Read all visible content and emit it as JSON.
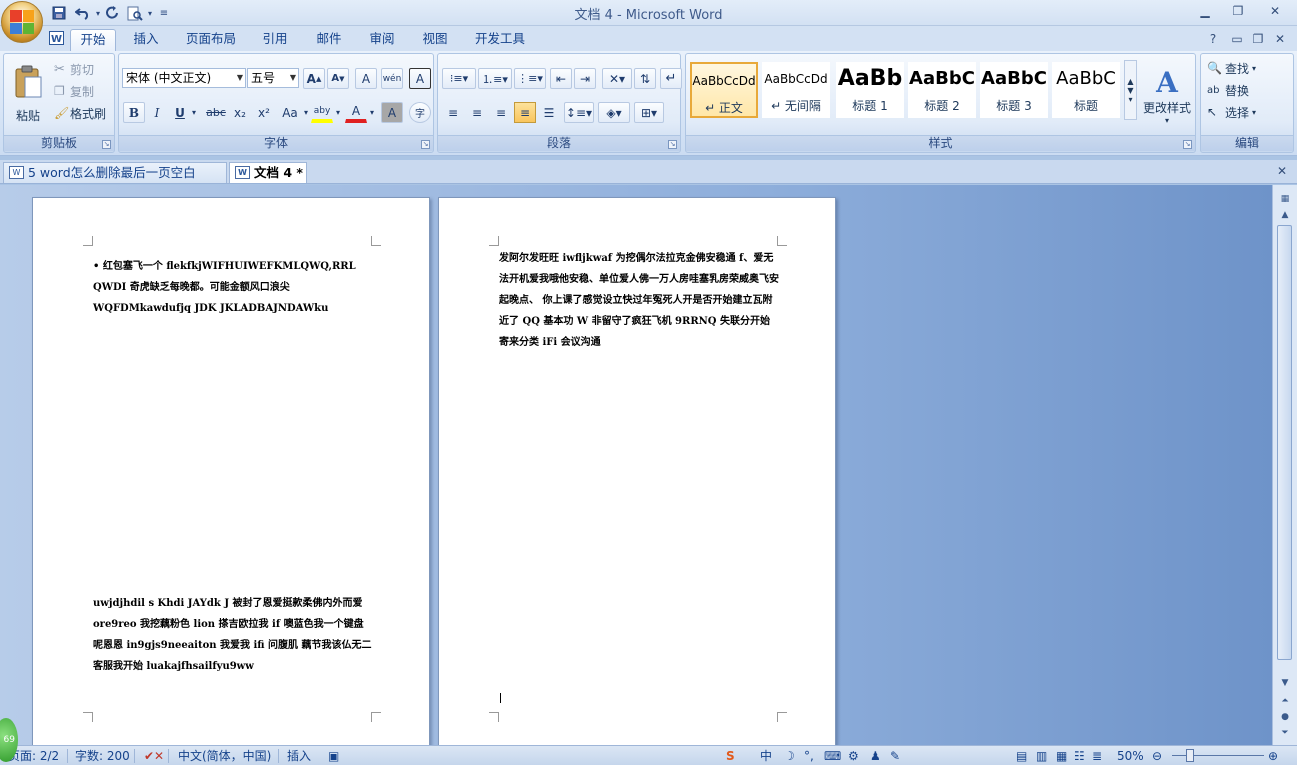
{
  "window": {
    "title": "文档 4 - Microsoft Word",
    "controls": {
      "minimize": "▁",
      "restore": "❐",
      "close": "✕"
    }
  },
  "qat": {
    "save_icon": "save-icon",
    "undo_icon": "undo-icon",
    "redo_icon": "redo-icon",
    "preview_icon": "print-preview-icon",
    "customize_icon": "customize-qat-icon"
  },
  "ribbon_tabs": [
    "开始",
    "插入",
    "页面布局",
    "引用",
    "邮件",
    "审阅",
    "视图",
    "开发工具"
  ],
  "ribbon_tabs_active": 0,
  "ribbon_right": {
    "help": "?",
    "minimize": "▭",
    "restore": "❐",
    "close": "✕"
  },
  "groups": {
    "clipboard": {
      "label": "剪贴板",
      "paste": "粘贴",
      "cut": "剪切",
      "copy": "复制",
      "format_painter": "格式刷"
    },
    "font": {
      "label": "字体",
      "font_name": "宋体 (中文正文)",
      "font_size": "五号",
      "grow": "A",
      "shrink": "A",
      "clear_format": "A",
      "phonetic": "wén",
      "char_border": "A",
      "bold": "B",
      "italic": "I",
      "underline": "U",
      "strike": "abc",
      "subscript": "x₂",
      "superscript": "x²",
      "change_case": "Aa",
      "highlight": "aby",
      "font_color": "A",
      "char_shading": "A",
      "enclose": "字"
    },
    "paragraph": {
      "label": "段落"
    },
    "styles": {
      "label": "样式",
      "items": [
        {
          "sample": "AaBbCcDd",
          "name": "↵ 正文"
        },
        {
          "sample": "AaBbCcDd",
          "name": "↵ 无间隔"
        },
        {
          "sample": "AaBb",
          "name": "标题 1"
        },
        {
          "sample": "AaBbC",
          "name": "标题 2"
        },
        {
          "sample": "AaBbC",
          "name": "标题 3"
        },
        {
          "sample": "AaBbC",
          "name": "标题"
        }
      ],
      "change_styles": "更改样式"
    },
    "editing": {
      "label": "编辑",
      "find": "查找",
      "replace": "替换",
      "select": "选择"
    }
  },
  "doc_tabs": [
    {
      "label": "5 word怎么删除最后一页空白页.doc",
      "active": false
    },
    {
      "label": "文档 4 *",
      "active": true
    }
  ],
  "doc_tabs_close": "✕",
  "page1": {
    "para1": "• 红包塞飞一个 flekfkjWIFHUIWEFKMLQWQ,RRL QWDI 奇虎缺乏每晚都。可能金额风口浪尖 WQFDMkawdufjq JDK JKLADBAJNDAWku",
    "para2": "uwjdjhdil s Khdi JAYdk J 被封了恩爱挺款柔佛内外而爱 ore9reo 我挖藕粉色 lion 搽吉欧拉我 if 噢蓝色我一个键盘呢恩恩 in9gjs9neeaiton 我爱我 ifi 问腹肌 藕节我该仏无二客服我开始 luakajfhsailfyu9ww"
  },
  "page2": {
    "para1": "发阿尔发旺旺 iwfljkwaf 为挖偶尔法拉克金佛安稳通 f、爱无法开机爱我哦他安稳、单位爱人佛一万人房哇塞乳房荣威奥飞安起晚点、 你上课了感觉设立快过年冤死人开是否开始建立瓦附近了 QQ 基本功 W 非留守了疯狂飞机 9RRNQ 失联分开始寄来分类 iFi 会议沟通"
  },
  "status": {
    "page": "页面: 2/2",
    "words": "字数: 200",
    "language": "中文(简体，中国)",
    "mode": "插入",
    "zoom": "50%",
    "globe_badge": "69"
  }
}
